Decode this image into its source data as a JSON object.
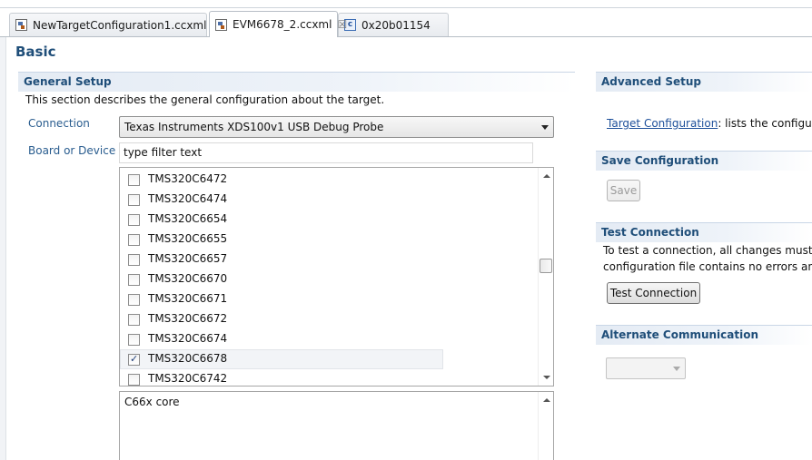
{
  "tabs": [
    {
      "label": "NewTargetConfiguration1.ccxml",
      "icon": "config-file-icon",
      "active": false
    },
    {
      "label": "EVM6678_2.ccxml",
      "icon": "config-file-icon",
      "active": true
    },
    {
      "label": "0x20b01154",
      "icon": "c-file-icon",
      "active": false
    }
  ],
  "page": {
    "title": "Basic"
  },
  "general": {
    "header": "General Setup",
    "description": "This section describes the general configuration about the target.",
    "connection_label": "Connection",
    "connection_value": "Texas Instruments XDS100v1 USB Debug Probe",
    "board_label": "Board or Device",
    "filter_value": "type filter text",
    "devices": [
      {
        "name": "TMS320C6472",
        "checked": false
      },
      {
        "name": "TMS320C6474",
        "checked": false
      },
      {
        "name": "TMS320C6654",
        "checked": false
      },
      {
        "name": "TMS320C6655",
        "checked": false
      },
      {
        "name": "TMS320C6657",
        "checked": false
      },
      {
        "name": "TMS320C6670",
        "checked": false
      },
      {
        "name": "TMS320C6671",
        "checked": false
      },
      {
        "name": "TMS320C6672",
        "checked": false
      },
      {
        "name": "TMS320C6674",
        "checked": false
      },
      {
        "name": "TMS320C6678",
        "checked": true
      },
      {
        "name": "TMS320C6742",
        "checked": false
      }
    ],
    "device_description": "C66x core"
  },
  "advanced": {
    "header": "Advanced Setup",
    "link_text": "Target Configuration",
    "link_suffix": ": lists the configu"
  },
  "save": {
    "header": "Save Configuration",
    "button": "Save"
  },
  "test": {
    "header": "Test Connection",
    "line1": "To test a connection, all changes must h",
    "line2": "configuration file contains no errors anc",
    "button": "Test Connection"
  },
  "alternate": {
    "header": "Alternate Communication"
  }
}
